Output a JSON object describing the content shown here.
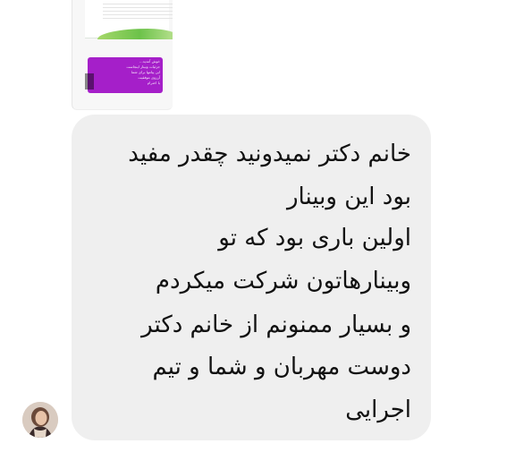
{
  "forwarded_image": {
    "card_text": "خوش آمدید... \nجزئیات وبینار اینجاست\nاین پیامها برای شما\nآرزوی موفقیت\nبا احترام"
  },
  "message": {
    "lines": [
      "خانم دکتر نمیدونید چقدر مفید",
      "بود این وبینار",
      "اولین باری بود که تو",
      "وبینارهاتون شرکت میکردم",
      "و بسیار ممنونم از خانم دکتر",
      "دوست مهربان و شما و تیم",
      "اجرایی"
    ]
  },
  "colors": {
    "bubble": "#efefef",
    "text": "#111111",
    "card": "#a51fc9"
  }
}
